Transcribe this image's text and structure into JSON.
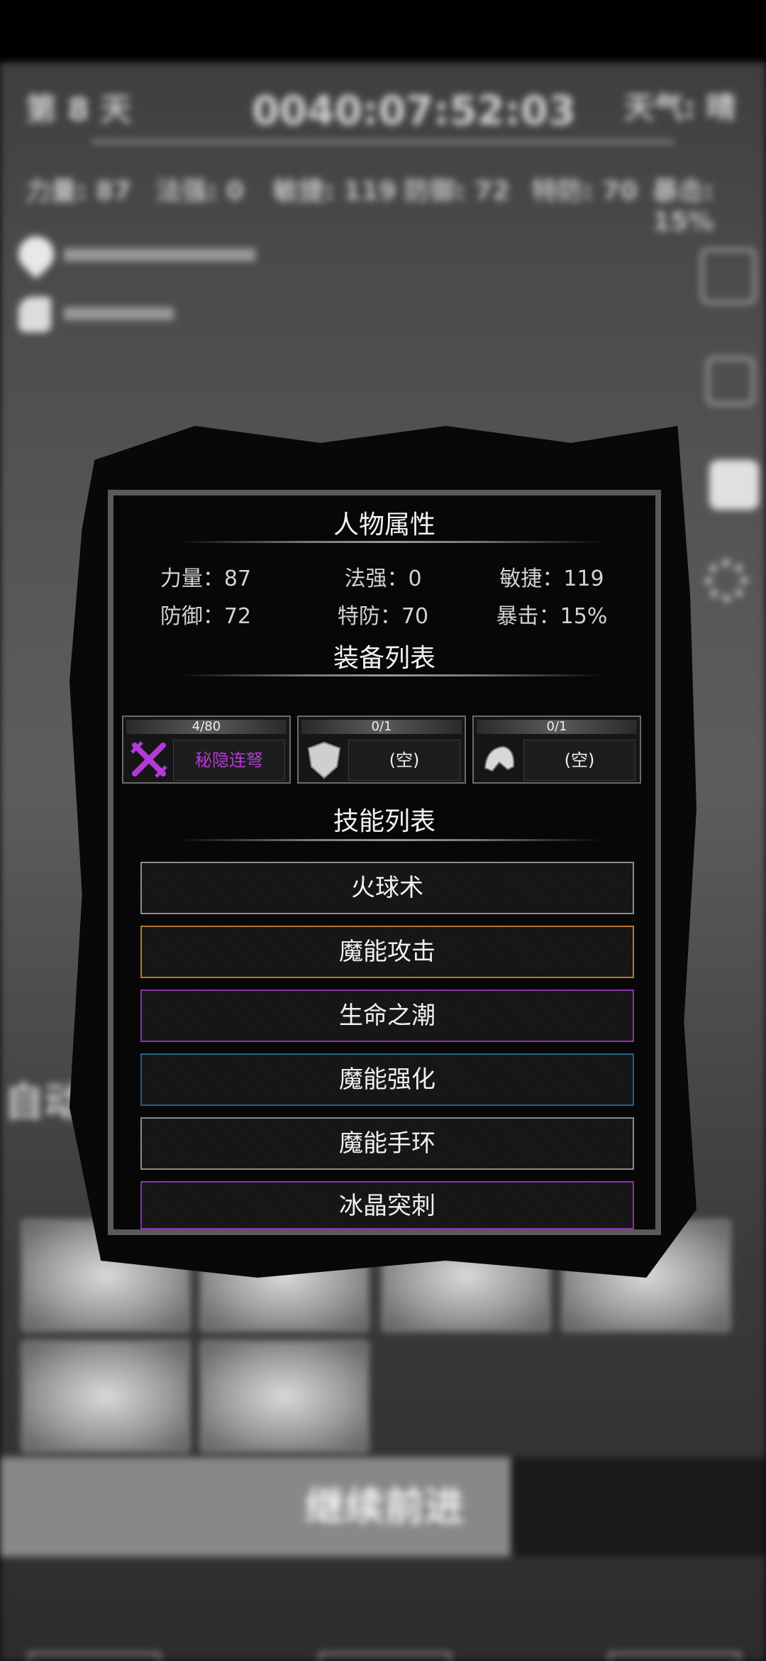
{
  "colors": {
    "rare_purple": "#b23ad6",
    "skill_border_gray": "#8a8a8a",
    "skill_border_orange": "#b47a2a",
    "skill_border_purple": "#8e2fb0",
    "skill_border_blue": "#245f8c"
  },
  "background": {
    "day": "第 8 天",
    "clock": "0040:07:52:03",
    "weather": "天气: 晴",
    "stats": [
      "力量: 87",
      "法强: 0",
      "敏捷: 119",
      "防御: 72",
      "特防: 70",
      "暴击: 15%"
    ],
    "auto_label": "自动",
    "cards": [
      "",
      "",
      "",
      "",
      "",
      ""
    ],
    "continue_label": "继续前进",
    "bottom_buttons": [
      "",
      "",
      ""
    ]
  },
  "modal": {
    "attributes_title": "人物属性",
    "attributes": [
      {
        "label": "力量：87"
      },
      {
        "label": "法强：0"
      },
      {
        "label": "敏捷：119"
      },
      {
        "label": "防御：72"
      },
      {
        "label": "特防：70"
      },
      {
        "label": "暴击：15%"
      }
    ],
    "equipment_title": "装备列表",
    "equipment": [
      {
        "count": "4/80",
        "name": "秘隐连弩",
        "icon": "crossed-crossbow-icon"
      },
      {
        "count": "0/1",
        "name": "(空)",
        "icon": "shield-icon"
      },
      {
        "count": "0/1",
        "name": "(空)",
        "icon": "helmet-icon"
      }
    ],
    "skills_title": "技能列表",
    "skills": [
      {
        "name": "火球术",
        "border": "gray"
      },
      {
        "name": "魔能攻击",
        "border": "orange"
      },
      {
        "name": "生命之潮",
        "border": "purple"
      },
      {
        "name": "魔能强化",
        "border": "blue"
      },
      {
        "name": "魔能手环",
        "border": "gray"
      },
      {
        "name": "冰晶突刺",
        "border": "purple"
      }
    ]
  }
}
